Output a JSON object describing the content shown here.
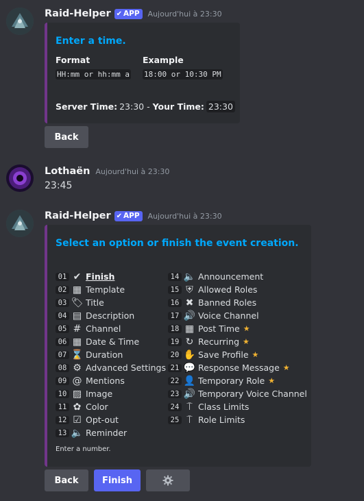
{
  "messages": [
    {
      "username": "Raid-Helper",
      "badge": "APP",
      "timestamp": "Aujourd'hui à 23:30",
      "embed": {
        "title": "Enter a time.",
        "format_header": "Format",
        "example_header": "Example",
        "format_value": "HH:mm or hh:mm a",
        "example_value": "18:00 or 10:30 PM",
        "server_time_label": "Server Time:",
        "server_time_value": "23:30",
        "separator": "-",
        "your_time_label": "Your Time:",
        "your_time_value": "23:30"
      },
      "buttons": {
        "back": "Back"
      }
    },
    {
      "username": "Lothaën",
      "timestamp": "Aujourd'hui à 23:30",
      "text": "23:45"
    },
    {
      "username": "Raid-Helper",
      "badge": "APP",
      "timestamp": "Aujourd'hui à 23:30",
      "embed": {
        "title": "Select an option or finish the event creation.",
        "options_left": [
          {
            "num": "01",
            "icon": "check-icon",
            "glyph": "✔",
            "label": "Finish"
          },
          {
            "num": "02",
            "icon": "template-icon",
            "glyph": "▦",
            "label": "Template"
          },
          {
            "num": "03",
            "icon": "tag-icon",
            "glyph": "🏷",
            "label": "Title"
          },
          {
            "num": "04",
            "icon": "description-icon",
            "glyph": "▤",
            "label": "Description"
          },
          {
            "num": "05",
            "icon": "hash-icon",
            "glyph": "#",
            "label": "Channel"
          },
          {
            "num": "06",
            "icon": "calendar-icon",
            "glyph": "▦",
            "label": "Date & Time"
          },
          {
            "num": "07",
            "icon": "hourglass-icon",
            "glyph": "⌛",
            "label": "Duration"
          },
          {
            "num": "08",
            "icon": "gears-icon",
            "glyph": "⚙",
            "label": "Advanced Settings"
          },
          {
            "num": "09",
            "icon": "at-icon",
            "glyph": "@",
            "label": "Mentions"
          },
          {
            "num": "10",
            "icon": "image-icon",
            "glyph": "▨",
            "label": "Image"
          },
          {
            "num": "11",
            "icon": "color-wheel-icon",
            "glyph": "✿",
            "label": "Color"
          },
          {
            "num": "12",
            "icon": "checkbox-icon",
            "glyph": "☑",
            "label": "Opt-out"
          },
          {
            "num": "13",
            "icon": "speaker-icon",
            "glyph": "🔈",
            "label": "Reminder"
          }
        ],
        "options_right": [
          {
            "num": "14",
            "icon": "speaker-icon",
            "glyph": "🔈",
            "label": "Announcement",
            "star": false
          },
          {
            "num": "15",
            "icon": "shield-check-icon",
            "glyph": "⛨",
            "label": "Allowed Roles",
            "star": false
          },
          {
            "num": "16",
            "icon": "banned-icon",
            "glyph": "✖",
            "label": "Banned Roles",
            "star": false
          },
          {
            "num": "17",
            "icon": "volume-icon",
            "glyph": "🔊",
            "label": "Voice Channel",
            "star": false
          },
          {
            "num": "18",
            "icon": "calendar-icon",
            "glyph": "▦",
            "label": "Post Time",
            "star": true
          },
          {
            "num": "19",
            "icon": "recurring-icon",
            "glyph": "↻",
            "label": "Recurring",
            "star": true
          },
          {
            "num": "20",
            "icon": "hand-icon",
            "glyph": "✋",
            "label": "Save Profile",
            "star": true
          },
          {
            "num": "21",
            "icon": "chat-icon",
            "glyph": "💬",
            "label": "Response Message",
            "star": true
          },
          {
            "num": "22",
            "icon": "person-icon",
            "glyph": "👤",
            "label": "Temporary Role",
            "star": true
          },
          {
            "num": "23",
            "icon": "volume-icon",
            "glyph": "🔊",
            "label": "Temporary Voice Channel",
            "star": false
          },
          {
            "num": "24",
            "icon": "class-limit-icon",
            "glyph": "⍑",
            "label": "Class Limits",
            "star": false
          },
          {
            "num": "25",
            "icon": "role-limit-icon",
            "glyph": "⍑",
            "label": "Role Limits",
            "star": false
          }
        ],
        "star_glyph": "★",
        "footer": "Enter a number."
      },
      "buttons": {
        "back": "Back",
        "finish": "Finish",
        "settings_icon": "gear-icon"
      }
    }
  ],
  "colors": {
    "background": "#323339",
    "embed_bg": "#2b2d31",
    "embed_border": "#71368a",
    "title_blue": "#00a8fc",
    "app_badge": "#5865f2",
    "button_grey": "#4e5058",
    "button_blurple": "#5865f2",
    "star": "#f0b232"
  }
}
